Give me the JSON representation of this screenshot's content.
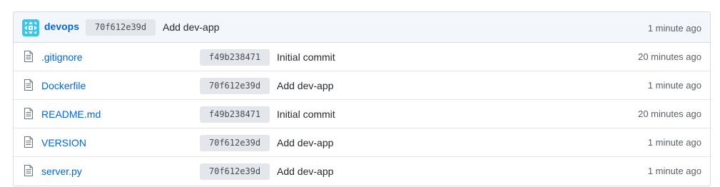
{
  "commit": {
    "author": "devops",
    "sha": "70f612e39d",
    "message": "Add dev-app",
    "age": "1 minute ago"
  },
  "files": [
    {
      "name": ".gitignore",
      "sha": "f49b238471",
      "message": "Initial commit",
      "age": "20 minutes ago"
    },
    {
      "name": "Dockerfile",
      "sha": "70f612e39d",
      "message": "Add dev-app",
      "age": "1 minute ago"
    },
    {
      "name": "README.md",
      "sha": "f49b238471",
      "message": "Initial commit",
      "age": "20 minutes ago"
    },
    {
      "name": "VERSION",
      "sha": "70f612e39d",
      "message": "Add dev-app",
      "age": "1 minute ago"
    },
    {
      "name": "server.py",
      "sha": "70f612e39d",
      "message": "Add dev-app",
      "age": "1 minute ago"
    }
  ],
  "colors": {
    "link": "#0366d6",
    "avatar": "#37c8e8",
    "header_bg": "#f3f6fa",
    "sha_bg": "#e3e6ea"
  },
  "icons": {
    "avatar": "identicon-avatar",
    "file": "file-icon"
  }
}
